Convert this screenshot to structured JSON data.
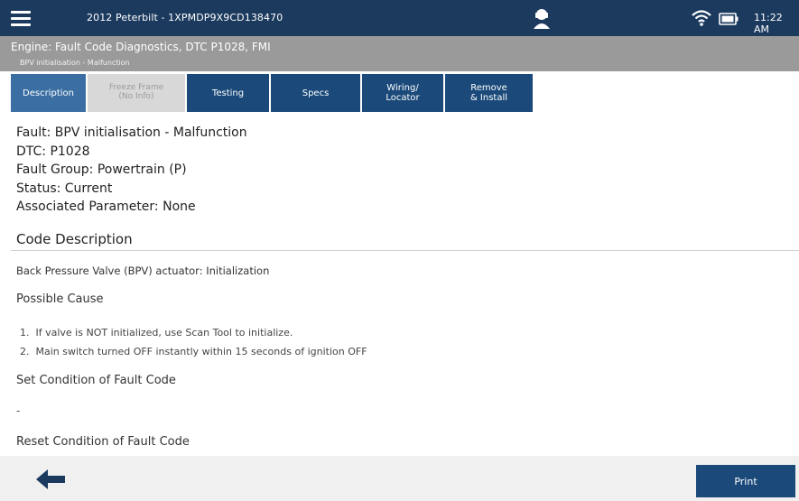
{
  "status_bar": {
    "menu_icon": "hamburger-menu-icon",
    "vehicle": "2012 Peterbilt - 1XPMDP9X9CD138470",
    "support_icon": "support-agent-icon",
    "wifi_icon": "wifi-icon",
    "battery_icon": "battery-icon",
    "time": "11:22 AM"
  },
  "header": {
    "title": "Engine: Fault Code Diagnostics, DTC P1028, FMI",
    "subtitle": "BPV initialisation - Malfunction"
  },
  "tabs": [
    {
      "label": "Description",
      "state": "active"
    },
    {
      "label": "Freeze Frame\n(No Info)",
      "state": "disabled"
    },
    {
      "label": "Testing",
      "state": "normal"
    },
    {
      "label": "Specs",
      "state": "normal"
    },
    {
      "label": "Wiring/\nLocator",
      "state": "normal"
    },
    {
      "label": "Remove\n& Install",
      "state": "normal"
    }
  ],
  "fault_info": {
    "fault": "Fault: BPV initialisation - Malfunction",
    "dtc": "DTC: P1028",
    "group": "Fault Group: Powertrain (P)",
    "status": "Status: Current",
    "parameter": "Associated Parameter: None"
  },
  "code_description": {
    "heading": "Code Description",
    "text": "Back Pressure Valve (BPV) actuator: Initialization"
  },
  "possible_cause": {
    "heading": "Possible Cause",
    "items": [
      "1.  If valve is NOT initialized, use Scan Tool to initialize.",
      "2.  Main switch turned OFF instantly within 15 seconds of ignition OFF"
    ]
  },
  "set_condition": {
    "heading": "Set Condition of Fault Code",
    "value": "-"
  },
  "reset_condition": {
    "heading": "Reset Condition of Fault Code"
  },
  "footer": {
    "back_icon": "back-arrow-icon",
    "print_label": "Print"
  },
  "colors": {
    "top_bar": "#1b3a5e",
    "title_bar": "#9a9a9a",
    "tab": "#1b4a7a",
    "tab_active": "#3b6fa3",
    "tab_disabled": "#d8d8d8"
  }
}
